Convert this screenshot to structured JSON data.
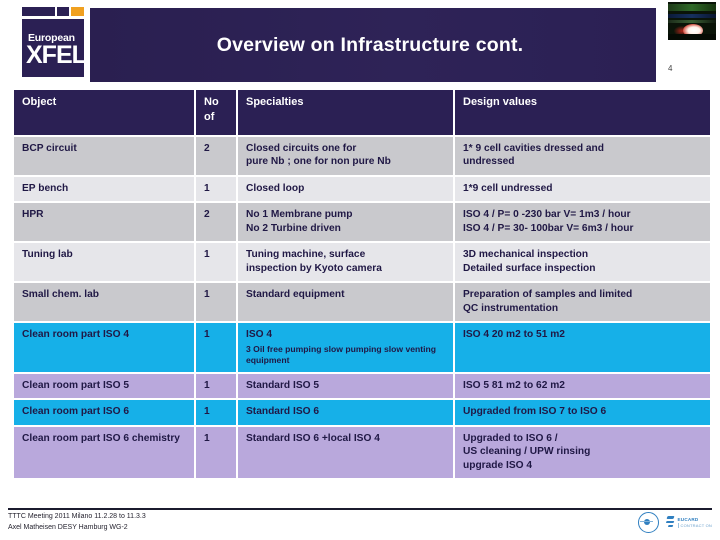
{
  "slide": {
    "title": "Overview on Infrastructure cont.",
    "page_number": "4",
    "logo": {
      "line1": "European",
      "line2": "XFEL",
      "accent_color": "#f0a020",
      "brand_color": "#2b2054"
    },
    "corner_photo_name": "abstract-beam-photo"
  },
  "table": {
    "headers": {
      "object": "Object",
      "no_of": "No\nof",
      "no_of_line1": "No",
      "no_of_line2": "of",
      "specialties": "Specialties",
      "design_values": "Design values"
    },
    "rows": [
      {
        "object": "BCP circuit",
        "no_of": "2",
        "specialties_line1": "Closed circuits one for",
        "specialties_line2": "pure Nb ; one for non pure Nb",
        "specialties_sub": "",
        "design_line1": "1* 9 cell cavities dressed and",
        "design_line2": "undressed",
        "design_line3": "",
        "tint": "dark",
        "design_red": false
      },
      {
        "object": "EP bench",
        "no_of": "1",
        "specialties_line1": "Closed loop",
        "specialties_line2": "",
        "specialties_sub": "",
        "design_line1": "1*9 cell undressed",
        "design_line2": "",
        "design_line3": "",
        "tint": "light",
        "design_red": false
      },
      {
        "object": "HPR",
        "no_of": "2",
        "specialties_line1": "No 1 Membrane pump",
        "specialties_line2": "No 2 Turbine driven",
        "specialties_sub": "",
        "design_line1": "ISO 4 / P= 0 -230 bar V= 1m3 / hour",
        "design_line2": "ISO 4 / P= 30- 100bar V= 6m3 / hour",
        "design_line3": "",
        "tint": "dark",
        "design_red": false
      },
      {
        "object": "Tuning lab",
        "no_of": "1",
        "specialties_line1": "Tuning machine, surface",
        "specialties_line2": "inspection by Kyoto camera",
        "specialties_sub": "",
        "design_line1": "3D mechanical inspection",
        "design_line2": "Detailed surface inspection",
        "design_line3": "",
        "tint": "light",
        "design_red": false
      },
      {
        "object": "Small chem. lab",
        "no_of": "1",
        "specialties_line1": "Standard equipment",
        "specialties_line2": "",
        "specialties_sub": "",
        "design_line1": "Preparation of samples and limited",
        "design_line2": "QC instrumentation",
        "design_line3": "",
        "tint": "dark",
        "design_red": false
      },
      {
        "object": "Clean room part ISO 4",
        "no_of": "1",
        "specialties_line1": "ISO 4",
        "specialties_line2": "",
        "specialties_sub": "3 Oil free pumping slow pumping slow venting equipment",
        "design_line1": "ISO 4 20 m2 to 51 m2",
        "design_line2": "",
        "design_line3": "",
        "tint": "cyan",
        "design_red": true
      },
      {
        "object": "Clean room part ISO 5",
        "no_of": "1",
        "specialties_line1": "Standard ISO 5",
        "specialties_line2": "",
        "specialties_sub": "",
        "design_line1": "ISO 5 81 m2 to 62 m2",
        "design_line2": "",
        "design_line3": "",
        "tint": "lilac",
        "design_red": true
      },
      {
        "object": "Clean room part ISO 6",
        "no_of": "1",
        "specialties_line1": "Standard ISO 6",
        "specialties_line2": "",
        "specialties_sub": "",
        "design_line1": "Upgraded from ISO 7 to ISO 6",
        "design_line2": "",
        "design_line3": "",
        "tint": "cyan",
        "design_red": true
      },
      {
        "object": "Clean room part ISO 6 chemistry",
        "no_of": "1",
        "specialties_line1": "Standard ISO 6 +local ISO 4",
        "specialties_line2": "",
        "specialties_sub": "",
        "design_line1": "Upgraded to ISO 6 /",
        "design_line2": "US cleaning / UPW rinsing",
        "design_line3": "upgrade ISO 4",
        "tint": "lilac",
        "design_red": true
      }
    ]
  },
  "footer": {
    "line1": "TTTC  Meeting 2011 Milano  11.2.28 to 11.3.3",
    "line2": "Axel Matheisen DESY Hamburg  WG-2",
    "logo1_name": "institute-circle-logo",
    "logo2_title": "EUCARD",
    "logo2_subtitle": "CONTRACT ON"
  }
}
